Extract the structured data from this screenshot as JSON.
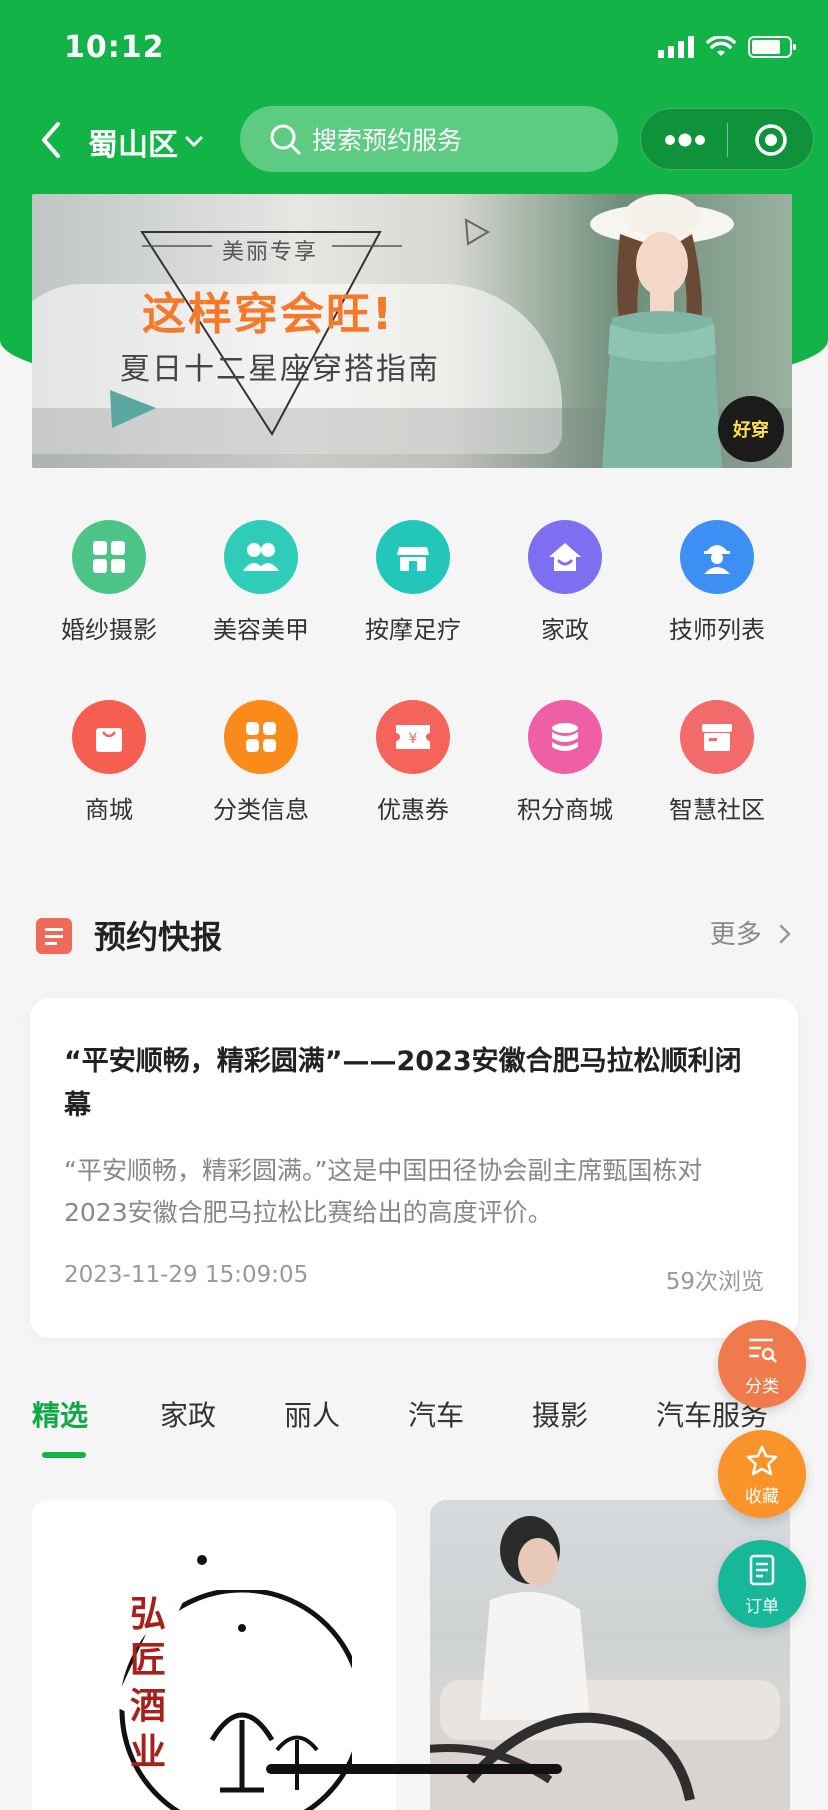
{
  "status_bar": {
    "time": "10:12"
  },
  "nav": {
    "city": "蜀山区",
    "search_placeholder": "搜索预约服务"
  },
  "banner": {
    "tag": "美丽专享",
    "title": "这样穿会旺!",
    "subtitle": "夏日十二星座穿搭指南",
    "badge": "好穿"
  },
  "grid": [
    {
      "label": "婚纱摄影",
      "icon": "grid-icon",
      "color": "#4cc485"
    },
    {
      "label": "美容美甲",
      "icon": "people-icon",
      "color": "#2fcdb9"
    },
    {
      "label": "按摩足疗",
      "icon": "shop-icon",
      "color": "#22c7ba"
    },
    {
      "label": "家政",
      "icon": "home-icon",
      "color": "#7e6ff0"
    },
    {
      "label": "技师列表",
      "icon": "worker-icon",
      "color": "#3d8ff3"
    },
    {
      "label": "商城",
      "icon": "bag-icon",
      "color": "#f55e50"
    },
    {
      "label": "分类信息",
      "icon": "apps-icon",
      "color": "#fa8a1a"
    },
    {
      "label": "优惠券",
      "icon": "coupon-icon",
      "color": "#f5645a"
    },
    {
      "label": "积分商城",
      "icon": "coins-icon",
      "color": "#ef5fa6"
    },
    {
      "label": "智慧社区",
      "icon": "box-icon",
      "color": "#f26a6a"
    }
  ],
  "news_section": {
    "title": "预约快报",
    "more": "更多"
  },
  "news": {
    "title": "“平安顺畅，精彩圆满”——2023安徽合肥马拉松顺利闭幕",
    "desc": "“平安顺畅，精彩圆满。”这是中国田径协会副主席甄国栋对2023安徽合肥马拉松比赛给出的高度评价。",
    "time": "2023-11-29 15:09:05",
    "views": "59次浏览"
  },
  "tabs": [
    "精选",
    "家政",
    "丽人",
    "汽车",
    "摄影",
    "汽车服务"
  ],
  "cards": {
    "card1_text": [
      "弘",
      "匠",
      "酒",
      "业"
    ]
  },
  "fabs": [
    {
      "label": "分类",
      "icon": "list-search-icon",
      "color": "#f07a4b"
    },
    {
      "label": "收藏",
      "icon": "star-icon",
      "color": "#f9932a"
    },
    {
      "label": "订单",
      "icon": "order-icon",
      "color": "#17b79a"
    }
  ]
}
